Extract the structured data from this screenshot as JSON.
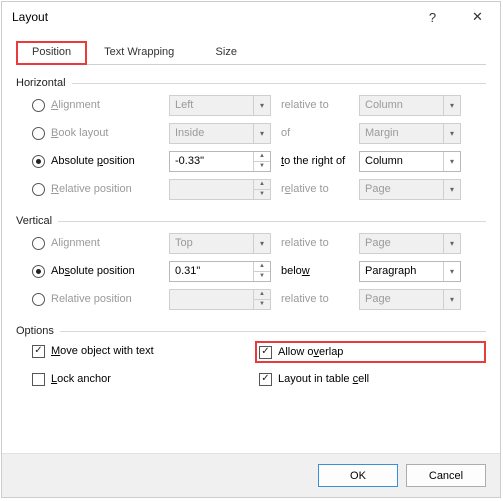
{
  "titlebar": {
    "title": "Layout"
  },
  "tabs": {
    "position": "Position",
    "textWrapping": "Text Wrapping",
    "size": "Size"
  },
  "groups": {
    "horizontal": "Horizontal",
    "vertical": "Vertical",
    "options": "Options"
  },
  "horizontal": {
    "alignment": {
      "label": "Alignment",
      "value": "Left",
      "relLabel": "relative to",
      "relValue": "Column"
    },
    "bookLayout": {
      "label": "Book layout",
      "value": "Inside",
      "relLabel": "of",
      "relValue": "Margin"
    },
    "absolute": {
      "label": "Absolute position",
      "value": "-0.33\"",
      "relLabel": "to the right of",
      "relValue": "Column"
    },
    "relative": {
      "label": "Relative position",
      "value": "",
      "relLabel": "relative to",
      "relValue": "Page"
    }
  },
  "vertical": {
    "alignment": {
      "label": "Alignment",
      "value": "Top",
      "relLabel": "relative to",
      "relValue": "Page"
    },
    "absolute": {
      "label": "Absolute position",
      "value": "0.31\"",
      "relLabel": "below",
      "relValue": "Paragraph"
    },
    "relative": {
      "label": "Relative position",
      "value": "",
      "relLabel": "relative to",
      "relValue": "Page"
    }
  },
  "options": {
    "moveWithText": "Move object with text",
    "allowOverlap": "Allow overlap",
    "lockAnchor": "Lock anchor",
    "layoutInCell": "Layout in table cell"
  },
  "buttons": {
    "ok": "OK",
    "cancel": "Cancel"
  }
}
